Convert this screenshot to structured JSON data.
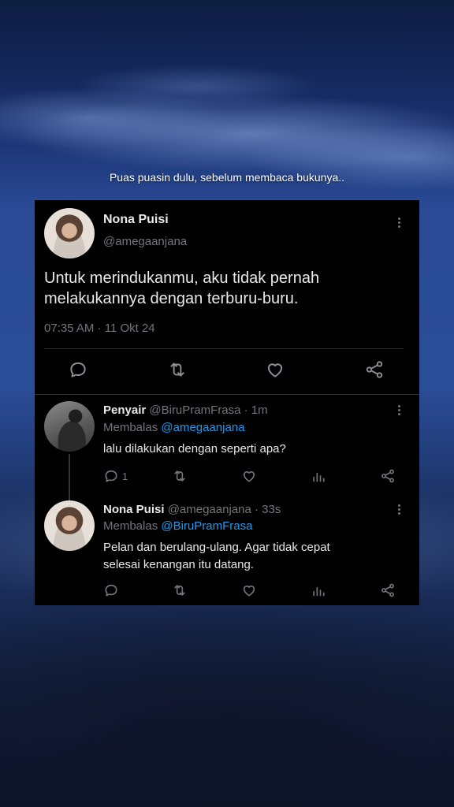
{
  "caption": "Puas puasin dulu, sebelum membaca bukunya..",
  "main_tweet": {
    "display_name": "Nona Puisi",
    "handle": "@amegaanjana",
    "text_line1": "Untuk merindukanmu, aku tidak pernah",
    "text_line2": "melakukannya dengan terburu-buru.",
    "timestamp": "07:35 AM · 11 Okt 24"
  },
  "replies": [
    {
      "display_name": "Penyair",
      "handle": "@BiruPramFrasa",
      "time": "· 1m",
      "replying_prefix": "Membalas",
      "replying_to": "@amegaanjana",
      "text_line1": "lalu dilakukan dengan seperti apa?",
      "text_line2": "",
      "reply_count": "1"
    },
    {
      "display_name": "Nona Puisi",
      "handle": "@amegaanjana",
      "time": "· 33s",
      "replying_prefix": "Membalas",
      "replying_to": "@BiruPramFrasa",
      "text_line1": "Pelan dan berulang-ulang. Agar tidak cepat",
      "text_line2": "selesai kenangan itu datang.",
      "reply_count": ""
    }
  ],
  "icons": [
    "reply-icon",
    "retweet-icon",
    "like-icon",
    "share-icon",
    "views-icon",
    "more-icon"
  ],
  "colors": {
    "card_bg": "#000000",
    "text": "#e7e9ea",
    "muted": "#71767b",
    "link": "#1d9bf0"
  }
}
